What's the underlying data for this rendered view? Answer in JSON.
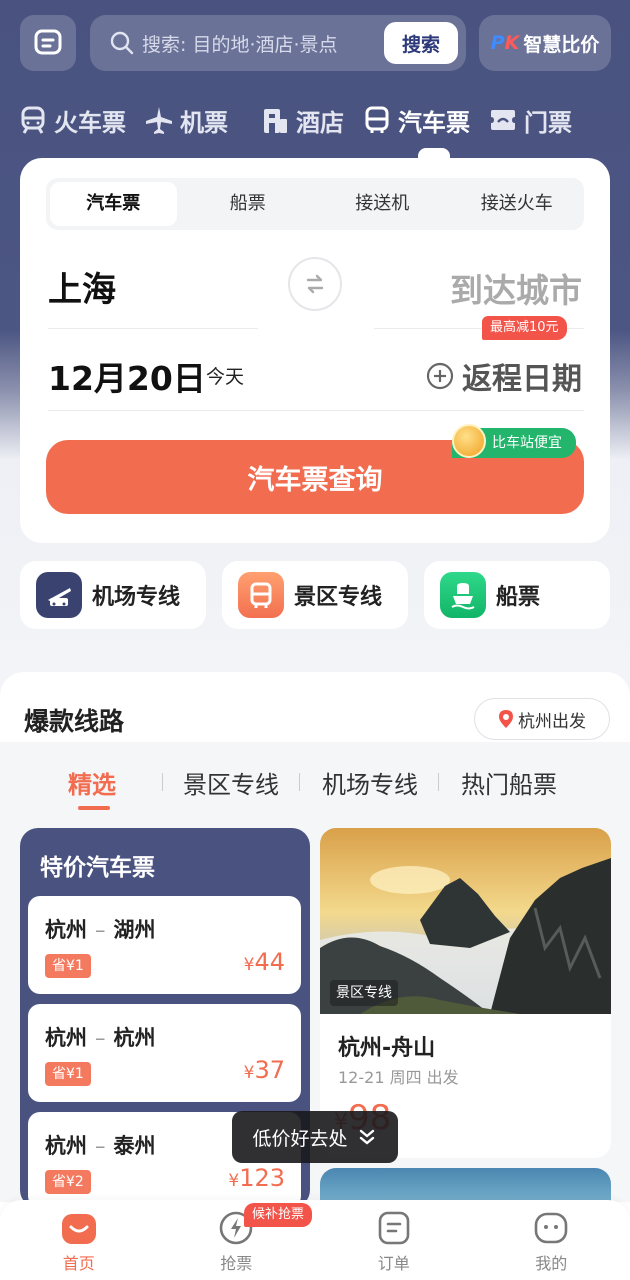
{
  "header": {
    "search_placeholder": "搜索: 目的地·酒店·景点",
    "search_button": "搜索",
    "pk_logo": "PK",
    "pk_label": "智慧比价"
  },
  "main_tabs": [
    {
      "label": "火车票",
      "icon": "train-icon"
    },
    {
      "label": "机票",
      "icon": "plane-icon"
    },
    {
      "label": "酒店",
      "icon": "hotel-icon"
    },
    {
      "label": "汽车票",
      "icon": "bus-icon",
      "active": true
    },
    {
      "label": "门票",
      "icon": "ticket-icon"
    }
  ],
  "sub_tabs": [
    {
      "label": "汽车票",
      "active": true
    },
    {
      "label": "船票"
    },
    {
      "label": "接送机"
    },
    {
      "label": "接送火车"
    }
  ],
  "search_form": {
    "from_city": "上海",
    "to_city_placeholder": "到达城市",
    "promo_tag": "最高减10元",
    "date": "12月20日",
    "date_hint": "今天",
    "return_label": "返程日期",
    "query_button": "汽车票查询",
    "cheap_tag": "比车站便宜"
  },
  "quick_entries": [
    {
      "label": "机场专线",
      "color": "#3a4270",
      "icon": "airport-bus-icon"
    },
    {
      "label": "景区专线",
      "color": "#f68a5c",
      "icon": "scenic-bus-icon"
    },
    {
      "label": "船票",
      "color": "#1ec77a",
      "icon": "ferry-icon"
    }
  ],
  "hot_routes": {
    "title": "爆款线路",
    "location": "杭州出发",
    "filter_tabs": [
      {
        "label": "精选",
        "active": true
      },
      {
        "label": "景区专线"
      },
      {
        "label": "机场专线"
      },
      {
        "label": "热门船票"
      }
    ],
    "deals_title": "特价汽车票",
    "deals": [
      {
        "from": "杭州",
        "to": "湖州",
        "save": "省¥1",
        "currency": "¥",
        "price": "44"
      },
      {
        "from": "杭州",
        "to": "杭州",
        "save": "省¥1",
        "currency": "¥",
        "price": "37"
      },
      {
        "from": "杭州",
        "to": "泰州",
        "save": "省¥2",
        "currency": "¥",
        "price": "123"
      }
    ],
    "scenic_card": {
      "tag": "景区专线",
      "name": "杭州-舟山",
      "date": "12-21 周四 出发",
      "currency": "¥",
      "price": "98"
    }
  },
  "toast": "低价好去处",
  "bottom_nav": [
    {
      "label": "首页",
      "icon": "home-icon",
      "active": true
    },
    {
      "label": "抢票",
      "icon": "grab-ticket-icon",
      "badge": "候补抢票"
    },
    {
      "label": "订单",
      "icon": "order-icon"
    },
    {
      "label": "我的",
      "icon": "profile-icon"
    }
  ],
  "colors": {
    "header_bg": "#4a5380",
    "accent": "#f26c50",
    "promo_red": "#f2544a",
    "cheap_green": "#22b56b"
  }
}
